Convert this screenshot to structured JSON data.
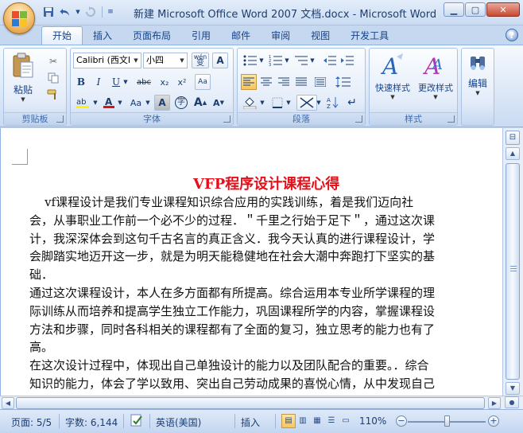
{
  "window": {
    "title": "新建 Microsoft Office Word 2007 文档.docx - Microsoft Word"
  },
  "quick_access": {
    "save": "save-icon",
    "undo": "undo-icon",
    "redo": "redo-icon",
    "customize": "customize-icon"
  },
  "tabs": [
    {
      "label": "开始",
      "active": true
    },
    {
      "label": "插入"
    },
    {
      "label": "页面布局"
    },
    {
      "label": "引用"
    },
    {
      "label": "邮件"
    },
    {
      "label": "审阅"
    },
    {
      "label": "视图"
    },
    {
      "label": "开发工具"
    }
  ],
  "ribbon": {
    "clipboard": {
      "label": "剪贴板",
      "paste": "粘贴"
    },
    "font": {
      "label": "字体",
      "font_name": "Calibri (西文I",
      "font_size": "小四",
      "wen": "wén",
      "wen_char": "变",
      "a_box": "A",
      "bold": "B",
      "italic": "I",
      "underline": "U",
      "strike": "abc",
      "sub": "x₂",
      "sup": "x²",
      "clear": "Aa",
      "change_case": "Aa",
      "char_shade": "A",
      "enclose": "字",
      "grow": "A",
      "shrink": "A"
    },
    "paragraph": {
      "label": "段落"
    },
    "styles": {
      "label": "样式",
      "quick": "快速样式",
      "change": "更改样式"
    },
    "editing": {
      "label": "编辑"
    }
  },
  "document": {
    "title": "VFP程序设计课程心得",
    "lines": [
      "    vf课程设计是我们专业课程知识综合应用的实践训练，着是我们迈向社",
      "会，从事职业工作前一个必不少的过程．＂千里之行始于足下＂，通过这次课",
      "计，我深深体会到这句千古名言的真正含义．我今天认真的进行课程设计，学",
      "会脚踏实地迈开这一步，就是为明天能稳健地在社会大潮中奔跑打下坚实的基",
      "础．",
      "通过这次课程设计，本人在多方面都有所提高。综合运用本专业所学课程的理",
      "际训练从而培养和提高学生独立工作能力，巩固课程所学的内容，掌握课程设",
      "方法和步骤，同时各科相关的课程都有了全面的复习，独立思考的能力也有了",
      "高。",
      "在这次设计过程中，体现出自己单独设计的能力以及团队配合的重要。．综合",
      "知识的能力，体会了学以致用、突出自己劳动成果的喜悦心情，从中发现自己"
    ]
  },
  "status": {
    "page": "页面: 5/5",
    "words": "字数: 6,144",
    "language": "英语(美国)",
    "mode": "插入",
    "zoom": "110%",
    "zoom_minus": "−",
    "zoom_plus": "+"
  }
}
